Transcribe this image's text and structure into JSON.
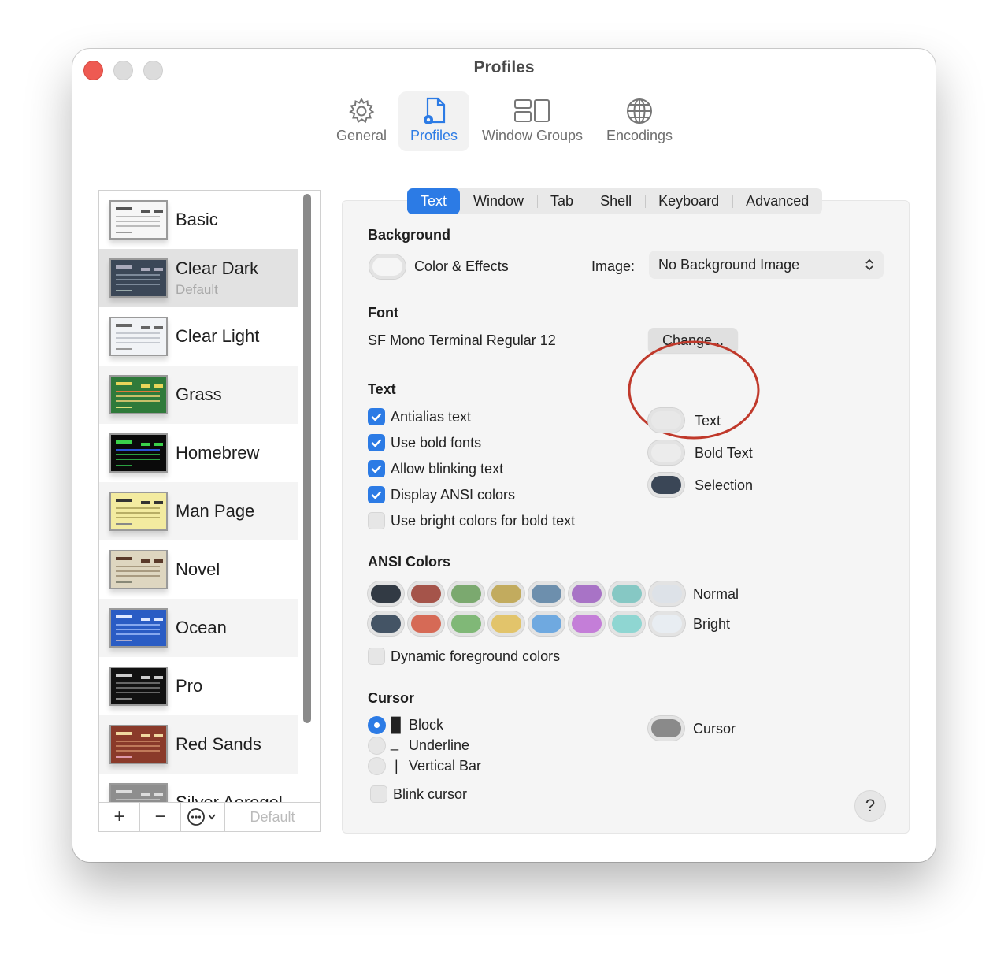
{
  "window": {
    "title": "Profiles"
  },
  "toolbar": [
    {
      "label": "General",
      "icon": "gear-icon"
    },
    {
      "label": "Profiles",
      "icon": "profile-doc-icon",
      "active": true
    },
    {
      "label": "Window Groups",
      "icon": "window-groups-icon"
    },
    {
      "label": "Encodings",
      "icon": "globe-icon"
    }
  ],
  "profiles": [
    {
      "name": "Basic",
      "sub": ""
    },
    {
      "name": "Clear Dark",
      "sub": "Default"
    },
    {
      "name": "Clear Light",
      "sub": ""
    },
    {
      "name": "Grass",
      "sub": ""
    },
    {
      "name": "Homebrew",
      "sub": ""
    },
    {
      "name": "Man Page",
      "sub": ""
    },
    {
      "name": "Novel",
      "sub": ""
    },
    {
      "name": "Ocean",
      "sub": ""
    },
    {
      "name": "Pro",
      "sub": ""
    },
    {
      "name": "Red Sands",
      "sub": ""
    },
    {
      "name": "Silver Aerogel",
      "sub": ""
    }
  ],
  "sidebar_footer": {
    "add": "+",
    "remove": "−",
    "default": "Default"
  },
  "tabs": [
    "Text",
    "Window",
    "Tab",
    "Shell",
    "Keyboard",
    "Advanced"
  ],
  "background": {
    "title": "Background",
    "color_effects": "Color & Effects",
    "image_label": "Image:",
    "image_value": "No Background Image"
  },
  "font": {
    "title": "Font",
    "value": "SF Mono Terminal Regular 12",
    "change_button": "Change..."
  },
  "text": {
    "title": "Text",
    "options": [
      {
        "label": "Antialias text",
        "checked": true
      },
      {
        "label": "Use bold fonts",
        "checked": true
      },
      {
        "label": "Allow blinking text",
        "checked": true
      },
      {
        "label": "Display ANSI colors",
        "checked": true
      },
      {
        "label": "Use bright colors for bold text",
        "checked": false
      }
    ],
    "colors": [
      {
        "label": "Text",
        "color": "#e8e8e8"
      },
      {
        "label": "Bold Text",
        "color": "#ececec"
      },
      {
        "label": "Selection",
        "color": "#3a4656"
      }
    ]
  },
  "ansi": {
    "title": "ANSI Colors",
    "normal_label": "Normal",
    "bright_label": "Bright",
    "normal": [
      "#323a44",
      "#a5544a",
      "#7ba96f",
      "#c2ab5e",
      "#6d8fad",
      "#a873c6",
      "#86c8c4",
      "#dde2e8"
    ],
    "bright": [
      "#445465",
      "#d66a56",
      "#80b877",
      "#e2c46b",
      "#6fa9e0",
      "#c47ed8",
      "#8fd6d2",
      "#e8edf2"
    ],
    "dynamic_label": "Dynamic foreground colors"
  },
  "cursor": {
    "title": "Cursor",
    "options": [
      {
        "glyph": "█",
        "label": "Block",
        "selected": true
      },
      {
        "glyph": "_",
        "label": "Underline",
        "selected": false
      },
      {
        "glyph": "|",
        "label": "Vertical Bar",
        "selected": false
      }
    ],
    "blink_label": "Blink cursor",
    "color_label": "Cursor",
    "color": "#8a8a8a"
  },
  "help": "?",
  "colors": {
    "accent": "#2c7be5",
    "annotation": "#c0392b"
  }
}
